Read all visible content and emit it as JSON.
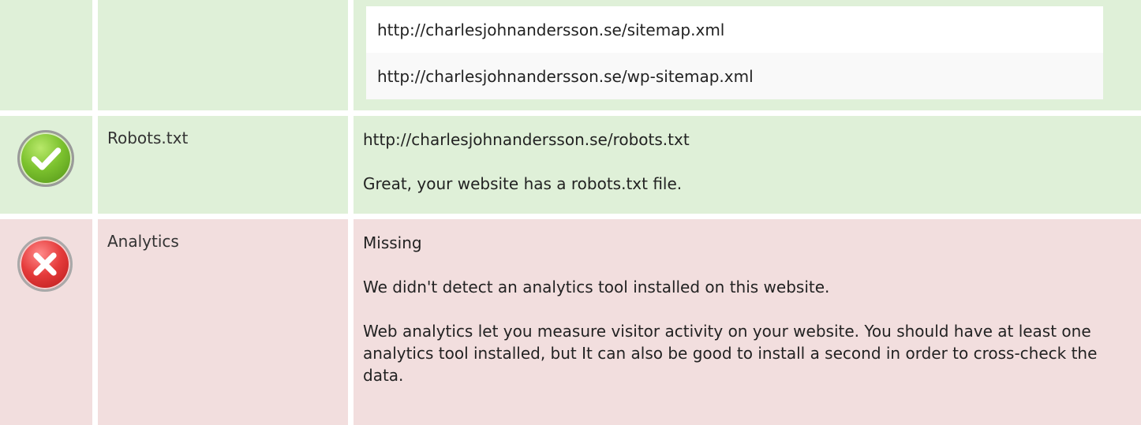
{
  "sitemap": {
    "urls": [
      "http://charlesjohnandersson.se/sitemap.xml",
      "http://charlesjohnandersson.se/wp-sitemap.xml"
    ]
  },
  "robots": {
    "label": "Robots.txt",
    "status": "pass",
    "icon": "check-icon",
    "value": "http://charlesjohnandersson.se/robots.txt",
    "message": "Great, your website has a robots.txt file."
  },
  "analytics": {
    "label": "Analytics",
    "status": "fail",
    "icon": "cross-icon",
    "value": "Missing",
    "message": "We didn't detect an analytics tool installed on this website.",
    "description": "Web analytics let you measure visitor activity on your website. You should have at least one analytics tool installed, but It can also be good to install a second in order to cross-check the data."
  },
  "colors": {
    "pass_bg": "#dff0d8",
    "fail_bg": "#f2dede"
  }
}
